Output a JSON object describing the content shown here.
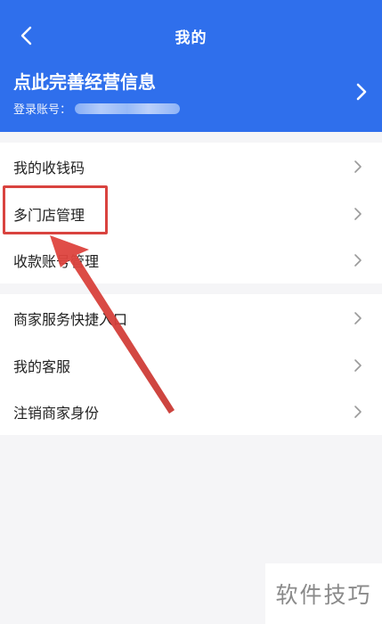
{
  "header": {
    "title": "我的",
    "back_icon": "back-chevron-icon",
    "profile_name": "点此完善经营信息",
    "account_label": "登录账号：",
    "profile_chevron_icon": "chevron-right-icon",
    "bg_color": "#2f6fec"
  },
  "menu_section_1": {
    "items": [
      {
        "label": "我的收钱码"
      },
      {
        "label": "多门店管理"
      },
      {
        "label": "收款账号管理"
      }
    ]
  },
  "menu_section_2": {
    "items": [
      {
        "label": "商家服务快捷入口"
      },
      {
        "label": "我的客服"
      },
      {
        "label": "注销商家身份"
      }
    ]
  },
  "annotation": {
    "highlight_color": "#d9433f",
    "highlighted_item": "多门店管理"
  },
  "watermark": {
    "text": "软件技巧"
  }
}
